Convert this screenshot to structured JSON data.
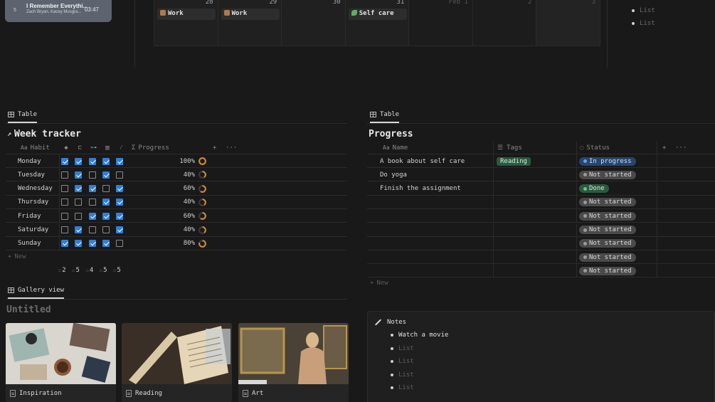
{
  "music": {
    "track_num": "5",
    "title": "I Remember Everythi...",
    "artists": "Zach Bryan, Kacey Musgra...",
    "time": "03:47"
  },
  "calendar": {
    "days": [
      {
        "num": "28",
        "event": "Work",
        "icon": "briefcase-icon",
        "out": false,
        "weekend": false
      },
      {
        "num": "29",
        "event": "Work",
        "icon": "briefcase-icon",
        "out": false,
        "weekend": false
      },
      {
        "num": "30",
        "event": "",
        "icon": "",
        "out": false,
        "weekend": false
      },
      {
        "num": "31",
        "event": "Self care",
        "icon": "leaf-icon",
        "out": false,
        "weekend": false
      },
      {
        "num": "Feb 1",
        "event": "",
        "icon": "",
        "out": true,
        "weekend": false
      },
      {
        "num": "2",
        "event": "",
        "icon": "",
        "out": true,
        "weekend": false
      },
      {
        "num": "3",
        "event": "",
        "icon": "",
        "out": true,
        "weekend": true
      }
    ]
  },
  "top_list": [
    "List",
    "List"
  ],
  "week_tracker": {
    "tab_label": "Table",
    "title": "Week tracker",
    "habit_header": "Habit",
    "habit_header_prefix": "Aa",
    "progress_header": "Progress",
    "progress_header_prefix": "Σ",
    "habit_icons": [
      "drop-icon",
      "bed-icon",
      "dumbbell-icon",
      "book-icon",
      "pen-icon"
    ],
    "rows": [
      {
        "day": "Monday",
        "checks": [
          true,
          true,
          true,
          true,
          true
        ],
        "progress": "100%",
        "pct": 100
      },
      {
        "day": "Tuesday",
        "checks": [
          false,
          true,
          false,
          true,
          false
        ],
        "progress": "40%",
        "pct": 40
      },
      {
        "day": "Wednesday",
        "checks": [
          false,
          true,
          true,
          false,
          true
        ],
        "progress": "60%",
        "pct": 60
      },
      {
        "day": "Thursday",
        "checks": [
          false,
          false,
          false,
          true,
          true
        ],
        "progress": "40%",
        "pct": 40
      },
      {
        "day": "Friday",
        "checks": [
          false,
          false,
          true,
          true,
          true
        ],
        "progress": "60%",
        "pct": 60
      },
      {
        "day": "Saturday",
        "checks": [
          false,
          true,
          false,
          false,
          true
        ],
        "progress": "40%",
        "pct": 40
      },
      {
        "day": "Sunday",
        "checks": [
          true,
          true,
          true,
          true,
          false
        ],
        "progress": "80%",
        "pct": 80
      }
    ],
    "new_label": "New",
    "new_prefix": "+",
    "totals": [
      "2",
      "5",
      "4",
      "5",
      "5"
    ],
    "add_column": "+",
    "more": "···"
  },
  "progress_table": {
    "tab_label": "Table",
    "title": "Progress",
    "name_header": "Name",
    "name_header_prefix": "Aa",
    "tags_header": "Tags",
    "status_header": "Status",
    "rows": [
      {
        "name": "A book about self care",
        "tag": "Reading",
        "status": "In progress",
        "status_kind": "inprogress"
      },
      {
        "name": "Do yoga",
        "tag": "",
        "status": "Not started",
        "status_kind": "notstarted"
      },
      {
        "name": "Finish the assignment",
        "tag": "",
        "status": "Done",
        "status_kind": "done"
      },
      {
        "name": "",
        "tag": "",
        "status": "Not started",
        "status_kind": "notstarted"
      },
      {
        "name": "",
        "tag": "",
        "status": "Not started",
        "status_kind": "notstarted"
      },
      {
        "name": "",
        "tag": "",
        "status": "Not started",
        "status_kind": "notstarted"
      },
      {
        "name": "",
        "tag": "",
        "status": "Not started",
        "status_kind": "notstarted"
      },
      {
        "name": "",
        "tag": "",
        "status": "Not started",
        "status_kind": "notstarted"
      },
      {
        "name": "",
        "tag": "",
        "status": "Not started",
        "status_kind": "notstarted"
      }
    ],
    "new_label": "New",
    "new_prefix": "+",
    "add_column": "+",
    "more": "···"
  },
  "gallery": {
    "tab_label": "Gallery view",
    "title": "Untitled",
    "cards": [
      {
        "label": "Inspiration"
      },
      {
        "label": "Reading"
      },
      {
        "label": "Art"
      }
    ]
  },
  "notes": {
    "title": "Notes",
    "items": [
      {
        "text": "Watch a movie",
        "placeholder": false
      },
      {
        "text": "List",
        "placeholder": true
      },
      {
        "text": "List",
        "placeholder": true
      },
      {
        "text": "List",
        "placeholder": true
      },
      {
        "text": "List",
        "placeholder": true
      }
    ]
  },
  "colors": {
    "background": "#191919",
    "checkbox_checked": "#2f80d9",
    "progress_ring": "#d08a2e",
    "tag_green": "#2b593f",
    "status_blue": "#28456c",
    "status_gray": "#4a4a4a"
  }
}
